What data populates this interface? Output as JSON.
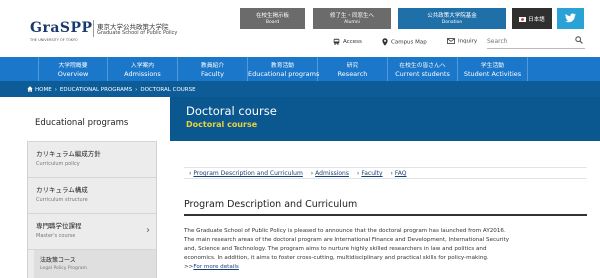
{
  "header": {
    "logo_main": "GraSPP",
    "logo_sub": "THE UNIVERSITY OF TOKYO",
    "logo_jp": "東京大学公共政策大学院",
    "logo_en": "Graduate School of Public Policy",
    "board": {
      "jp": "在校生掲示板",
      "en": "Board"
    },
    "alumni": {
      "jp": "修了生・同窓生へ",
      "en": "Alumni"
    },
    "donation": {
      "jp": "公共政策大学院基金",
      "en": "Donation"
    },
    "japanese": "日本語",
    "access": "Access",
    "campus_map": "Campus Map",
    "inquiry": "Inquiry",
    "search_placeholder": "Search",
    "colors": {
      "board_bg": "#6b6b6b",
      "donation_bg": "#1f6fa8",
      "twitter_bg": "#2aa2d6"
    }
  },
  "nav": [
    {
      "jp": "大学院概要",
      "en": "Overview"
    },
    {
      "jp": "入学案内",
      "en": "Admissions"
    },
    {
      "jp": "教員紹介",
      "en": "Faculty"
    },
    {
      "jp": "教育活動",
      "en": "Educational programs"
    },
    {
      "jp": "研究",
      "en": "Research"
    },
    {
      "jp": "在校生の皆さんへ",
      "en": "Current students"
    },
    {
      "jp": "学生活動",
      "en": "Student Activities"
    }
  ],
  "breadcrumb": {
    "home": "HOME",
    "level1": "EDUCATIONAL PROGRAMS",
    "level2": "DOCTORAL COURSE"
  },
  "page_title": {
    "main": "Doctoral course",
    "sub": "Doctoral course"
  },
  "sidebar": {
    "heading": "Educational programs",
    "items": [
      {
        "jp": "カリキュラム編成方針",
        "en": "Curriculum policy"
      },
      {
        "jp": "カリキュラム構成",
        "en": "Curriculum structure"
      },
      {
        "jp": "専門職学位課程",
        "en": "Master's course"
      }
    ],
    "subitem": {
      "jp": "法政策コース",
      "en": "Legal Policy Program"
    }
  },
  "subnav": {
    "links": [
      "Program Description and Curriculum",
      "Admissions",
      "Faculty",
      "FAQ"
    ]
  },
  "section": {
    "title": "Program Description and Curriculum",
    "paragraph_lines": [
      "The Graduate School of Public Policy is pleased to announce that the doctoral program has launched from AY2016.",
      "The main research areas of the doctoral program are International Finance and Development, International Security",
      "and, Science and Technology. The program aims to nurture highly skilled researchers in law and politics and",
      "economics. In addition, it aims to foster cross-cutting, multidisciplinary and practical skills for policy-making."
    ],
    "more_prefix": ">>",
    "more_link": "For more details"
  }
}
